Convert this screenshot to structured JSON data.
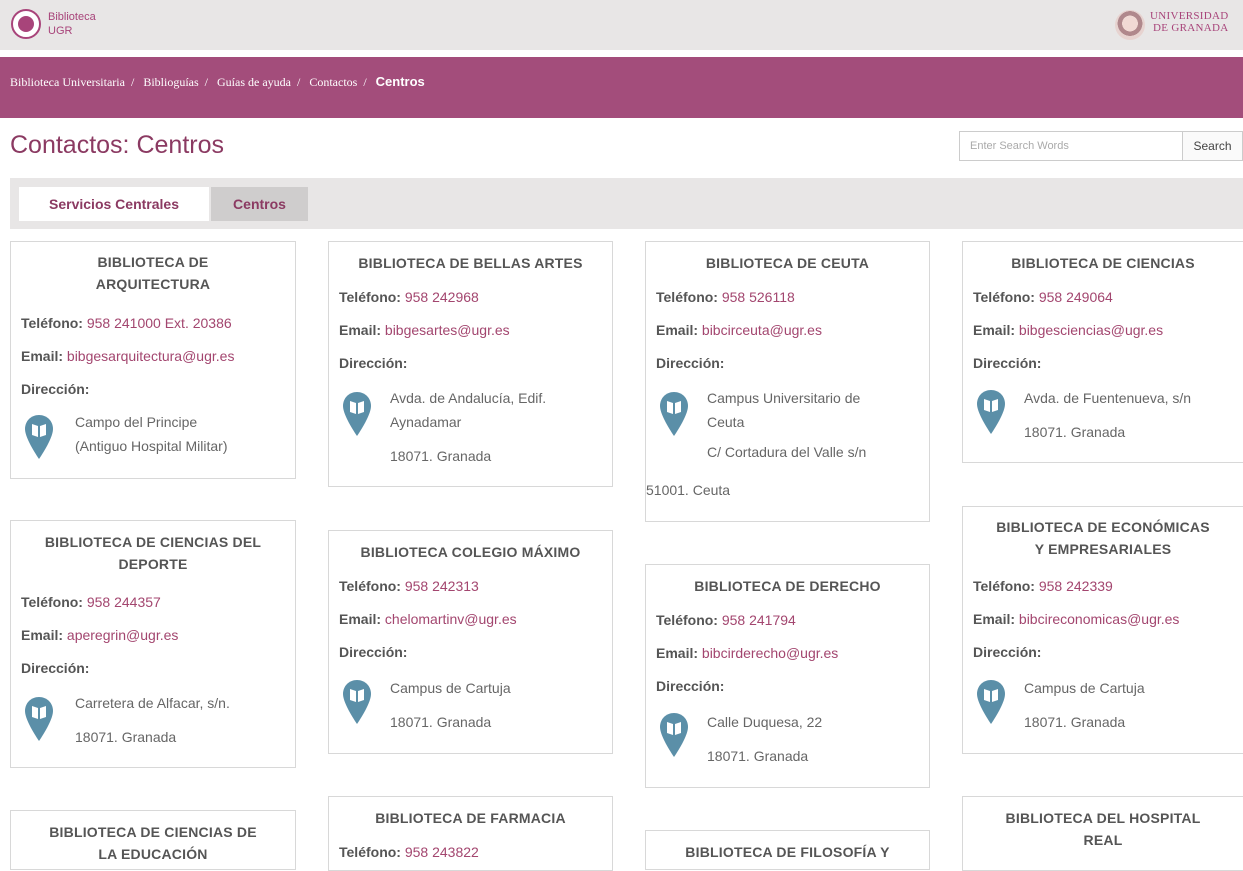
{
  "header": {
    "logo_line1": "Biblioteca",
    "logo_line2": "UGR",
    "university_line1": "UNIVERSIDAD",
    "university_line2": "DE GRANADA"
  },
  "breadcrumb": [
    "Biblioteca Universitaria",
    "Biblioguías",
    "Guías de ayuda",
    "Contactos",
    "Centros"
  ],
  "page_title": "Contactos: Centros",
  "search": {
    "placeholder": "Enter Search Words",
    "button": "Search"
  },
  "tabs": [
    {
      "label": "Servicios Centrales"
    },
    {
      "label": "Centros"
    }
  ],
  "labels": {
    "phone": "Teléfono:",
    "email": "Email:",
    "address": "Dirección:"
  },
  "cards": [
    {
      "title1": "BIBLIOTECA DE",
      "title2": "ARQUITECTURA",
      "phone": "958 241000 Ext. 20386",
      "email": "bibgesarquitectura@ugr.es",
      "addr1": "Campo del Principe",
      "addr2": "(Antiguo Hospital Militar)"
    },
    {
      "title1": "BIBLIOTECA DE BELLAS ARTES",
      "phone": "958 242968",
      "email": "bibgesartes@ugr.es",
      "addr1": "Avda. de Andalucía, Edif.",
      "addr2": "Aynadamar",
      "addr3": "18071. Granada"
    },
    {
      "title1": "BIBLIOTECA DE CEUTA",
      "phone": "958 526118",
      "email": "bibcirceuta@ugr.es",
      "addr1": "Campus Universitario de",
      "addr2": "Ceuta",
      "addr3": "C/ Cortadura del Valle s/n",
      "addr4": "51001. Ceuta"
    },
    {
      "title1": "BIBLIOTECA DE CIENCIAS",
      "phone": "958 249064",
      "email": "bibgesciencias@ugr.es",
      "addr1": "Avda. de Fuentenueva, s/n",
      "addr2": "18071. Granada"
    },
    {
      "title1": "BIBLIOTECA DE CIENCIAS DEL",
      "title2": "DEPORTE",
      "phone": "958 244357",
      "email": "aperegrin@ugr.es",
      "addr1": "Carretera de Alfacar, s/n.",
      "addr2": "18071. Granada"
    },
    {
      "title1": "BIBLIOTECA COLEGIO MÁXIMO",
      "phone": "958 242313",
      "email": "chelomartinv@ugr.es",
      "addr1": "Campus de Cartuja",
      "addr2": "18071. Granada"
    },
    {
      "title1": "BIBLIOTECA DE DERECHO",
      "phone": "958 241794",
      "email": "bibcirderecho@ugr.es",
      "addr1": "Calle Duquesa, 22",
      "addr2": "18071. Granada"
    },
    {
      "title1": "BIBLIOTECA DE ECONÓMICAS",
      "title2": "Y EMPRESARIALES",
      "phone": "958 242339",
      "email": "bibcireconomicas@ugr.es",
      "addr1": "Campus de Cartuja",
      "addr2": "18071. Granada"
    },
    {
      "title1": "BIBLIOTECA DE CIENCIAS DE",
      "title2": "LA EDUCACIÓN"
    },
    {
      "title1": "BIBLIOTECA DE FARMACIA",
      "phone": "958 243822"
    },
    {
      "title1": "BIBLIOTECA DE FILOSOFÍA Y"
    },
    {
      "title1": "BIBLIOTECA DEL HOSPITAL",
      "title2": "REAL"
    }
  ]
}
